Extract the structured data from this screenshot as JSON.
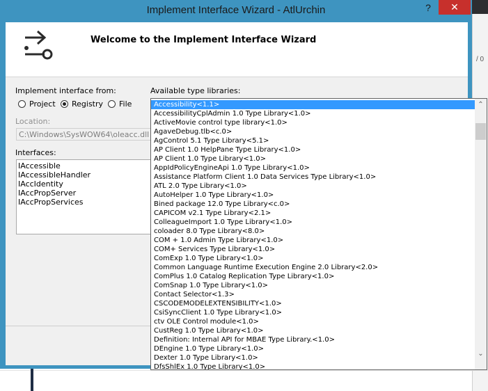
{
  "window": {
    "title": "Implement Interface Wizard - AtlUrchin",
    "help": "?",
    "close": "✕"
  },
  "header": {
    "title": "Welcome to the Implement Interface Wizard"
  },
  "implement_from": {
    "label": "Implement interface from:",
    "options": [
      "Project",
      "Registry",
      "File"
    ],
    "selected": "Registry"
  },
  "location": {
    "label": "Location:",
    "value": "C:\\Windows\\SysWOW64\\oleacc.dll"
  },
  "interfaces": {
    "label": "Interfaces:",
    "items": [
      "IAccessible",
      "IAccessibleHandler",
      "IAccIdentity",
      "IAccPropServer",
      "IAccPropServices"
    ]
  },
  "type_libraries": {
    "label": "Available type libraries:",
    "selected": "Accessibility<1.1>",
    "items": [
      "Accessibility<1.1>",
      "AccessibilityCplAdmin 1.0 Type Library<1.0>",
      "ActiveMovie control type library<1.0>",
      "AgaveDebug.tlb<c.0>",
      "AgControl 5.1 Type Library<5.1>",
      "AP Client 1.0 HelpPane Type Library<1.0>",
      "AP Client 1.0 Type Library<1.0>",
      "AppIdPolicyEngineApi 1.0 Type Library<1.0>",
      "Assistance Platform Client 1.0 Data Services Type Library<1.0>",
      "ATL 2.0 Type Library<1.0>",
      "AutoHelper 1.0 Type Library<1.0>",
      "Bined package 12.0 Type Library<c.0>",
      "CAPICOM v2.1 Type Library<2.1>",
      "ColleagueImport 1.0 Type Library<1.0>",
      "coloader 8.0 Type Library<8.0>",
      "COM + 1.0 Admin Type Library<1.0>",
      "COM+ Services Type Library<1.0>",
      "ComExp 1.0 Type Library<1.0>",
      "Common Language Runtime Execution Engine 2.0 Library<2.0>",
      "ComPlus 1.0 Catalog Replication Type Library<1.0>",
      "ComSnap 1.0 Type Library<1.0>",
      "Contact Selector<1.3>",
      "CSCODEMODELEXTENSIBILITY<1.0>",
      "CsiSyncClient 1.0 Type Library<1.0>",
      "ctv OLE Control module<1.0>",
      "CustReg 1.0 Type Library<1.0>",
      "Definition: Internal API for MBAE Type Library.<1.0>",
      "DEngine 1.0 Type Library<1.0>",
      "Dexter 1.0 Type Library<1.0>",
      "DfsShlEx 1.0 Type Library<1.0>"
    ]
  },
  "background": {
    "glyph": "/ 0"
  },
  "colors": {
    "title_bar": "#3e94c0",
    "close_button": "#c7302c",
    "selection": "#3399ff"
  }
}
